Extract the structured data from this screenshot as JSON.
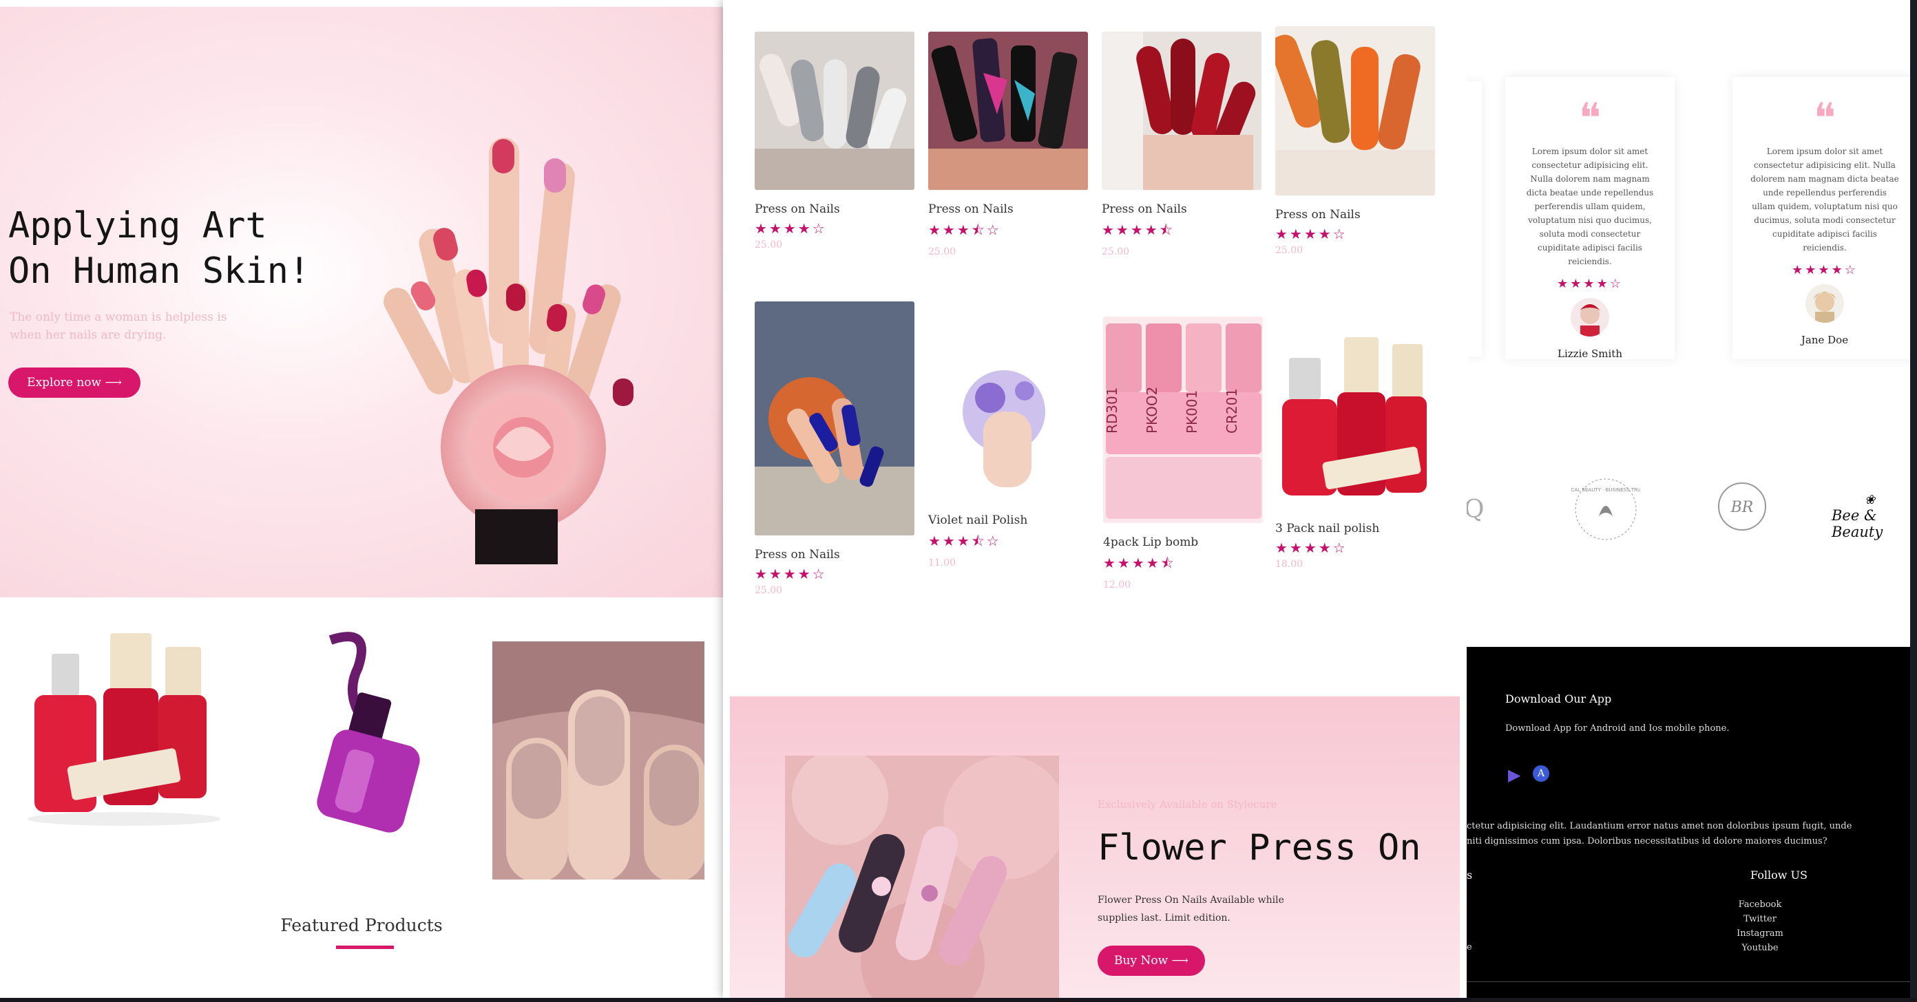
{
  "hero": {
    "title": "Applying Art\nOn Human Skin!",
    "subtitle": "The only time a woman is helpless is when her nails are drying.",
    "cta": "Explore now ⟶"
  },
  "featured": {
    "heading": "Featured Products"
  },
  "products": [
    {
      "name": "Press on Nails",
      "rating": 4,
      "price": "25.00"
    },
    {
      "name": "Press on Nails",
      "rating": 3.5,
      "price": "25.00"
    },
    {
      "name": "Press on Nails",
      "rating": 4.5,
      "price": "25.00"
    },
    {
      "name": "Press on Nails",
      "rating": 4,
      "price": "25.00"
    },
    {
      "name": "Press on Nails",
      "rating": 4,
      "price": "25.00"
    },
    {
      "name": "Violet nail Polish",
      "rating": 3.5,
      "price": "11.00"
    },
    {
      "name": "4pack Lip bomb",
      "rating": 4.5,
      "price": "12.00"
    },
    {
      "name": "3 Pack nail polish",
      "rating": 4,
      "price": "18.00"
    }
  ],
  "stars": {
    "p0": "★★★★☆",
    "p1": "★★★⯪☆",
    "p2": "★★★★⯪",
    "p3": "★★★★☆",
    "p4": "★★★★☆",
    "p5": "★★★⯪☆",
    "p6": "★★★★⯪",
    "p7": "★★★★☆",
    "t0": "★★★★☆",
    "t1": "★★★★☆"
  },
  "lipbomb_labels": [
    "RD301",
    "PKOO2",
    "PK001",
    "CR201"
  ],
  "promo": {
    "tag": "Exclusively Available on Stylecure",
    "title": "Flower Press On",
    "desc": "Flower Press On Nails Available while supplies last. Limit edition.",
    "cta": "Buy Now ⟶"
  },
  "testimonials": [
    {
      "text": "Lorem ipsum dolor sit amet consectetur adipisicing elit. Nulla dolorem nam magnam dicta beatae unde repellendus perferendis ullam quidem, voluptatum nisi quo ducimus, soluta modi consectetur cupiditate adipisci facilis reiciendis.",
      "rating": 4,
      "name": "Lizzie Smith"
    },
    {
      "text": "Lorem ipsum dolor sit amet consectetur adipisicing elit. Nulla dolorem nam magnam dicta beatae unde repellendus perferendis ullam quidem, voluptatum nisi quo ducimus, soluta modi consectetur cupiditate adipisci facilis reiciendis.",
      "rating": 4,
      "name": "Jane Doe"
    }
  ],
  "quote_mark": "❝",
  "brands": [
    "Q",
    "LOCAL BEAUTY · BUSINESS TRUST",
    "BR",
    "Bee & Beauty"
  ],
  "footer": {
    "app_heading": "Download Our App",
    "app_text": "Download App for Android and Ios mobile phone.",
    "about_text": "ctetur adipisicing elit. Laudantium error natus amet non doloribus ipsum fugit, unde\nniti dignissimos cum ipsa. Doloribus necessitatibus id dolore maiores ducimus?",
    "links_heading": "s",
    "follow_heading": "Follow US",
    "follow_links": [
      "Facebook",
      "Twitter",
      "Instagram",
      "Youtube"
    ],
    "trail": "e"
  },
  "colors": {
    "accent": "#d8176a",
    "star": "#c4116b",
    "hero_bg": "#f9d3dc",
    "footer_bg": "#000000"
  }
}
